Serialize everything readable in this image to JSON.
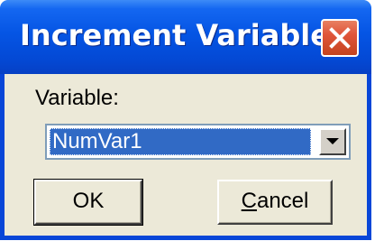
{
  "window": {
    "title": "Increment Variable",
    "close_icon": "close-x-icon"
  },
  "form": {
    "variable_label": "Variable:",
    "variable_value": "NumVar1",
    "dropdown_icon": "chevron-down-icon"
  },
  "buttons": {
    "ok_label": "OK",
    "cancel_accel": "C",
    "cancel_rest": "ancel"
  },
  "colors": {
    "titlebar": "#0555e4",
    "close_button": "#e0553a",
    "client": "#ece9d8",
    "selection": "#316ac5"
  }
}
